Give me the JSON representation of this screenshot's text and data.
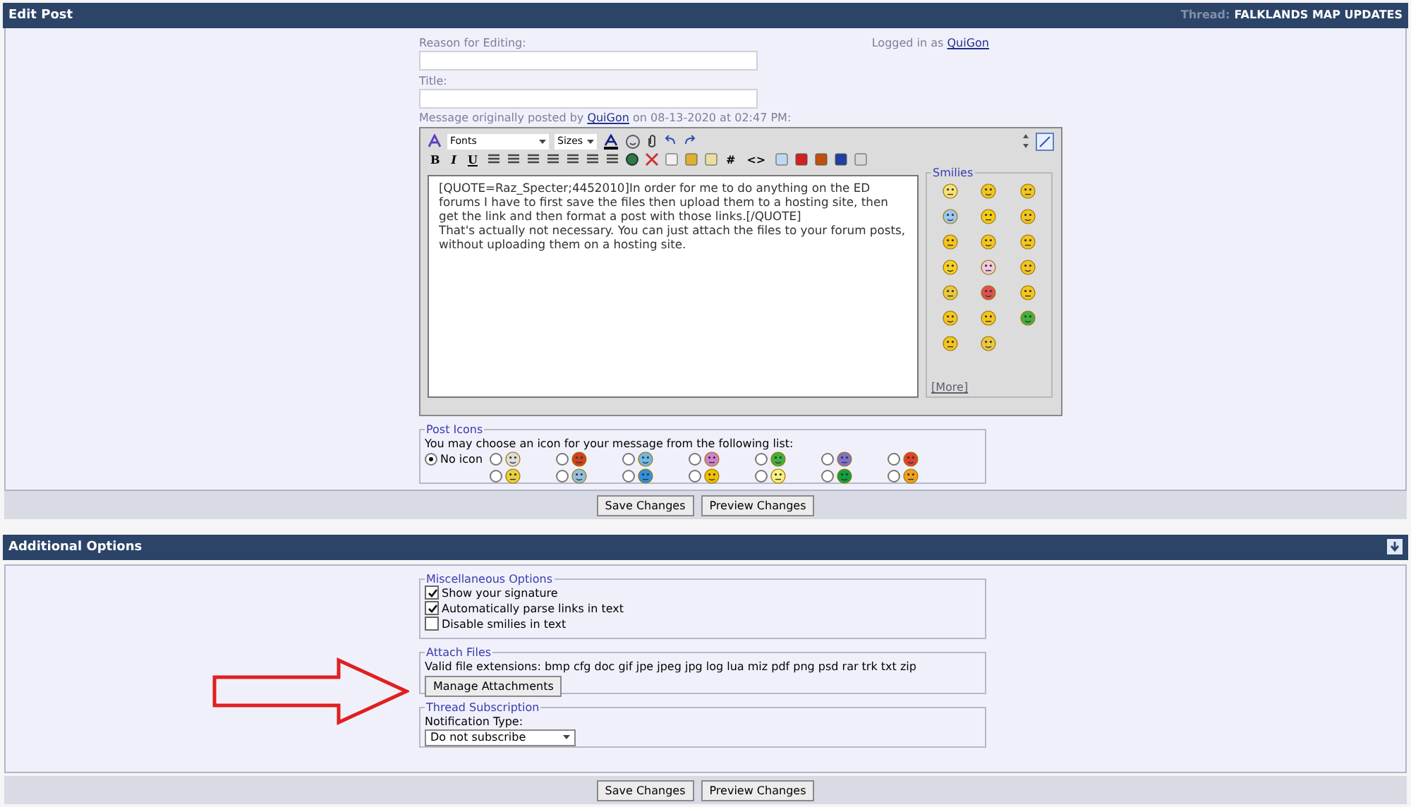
{
  "edit_post": {
    "title": "Edit Post",
    "thread_label": "Thread:",
    "thread_name": "FALKLANDS MAP UPDATES",
    "reason_label": "Reason for Editing:",
    "logged_in_text": "Logged in as",
    "logged_in_user": "QuiGon",
    "title_label": "Title:",
    "original_prefix": "Message originally posted by",
    "original_author": "QuiGon",
    "original_suffix": "on 08-13-2020 at 02:47 PM:",
    "editor": {
      "font_select": "Fonts",
      "size_select": "Sizes",
      "format_buttons": [
        "B",
        "I",
        "U"
      ],
      "hash_button": "#",
      "code_button": "<>",
      "message": "[QUOTE=Raz_Specter;4452010]In order for me to do anything on the ED forums I have to first save the files then upload them to a hosting site, then get the link and then format a post with those links.[/QUOTE]\nThat's actually not necessary. You can just attach the files to your forum posts, without uploading them on a hosting site.",
      "smilies_title": "Smilies",
      "more_link": "[More]"
    },
    "post_icons": {
      "title": "Post Icons",
      "instruction": "You may choose an icon for your message from the following list:",
      "options": [
        {
          "label": "No icon",
          "selected": true
        },
        {
          "selected": false
        },
        {
          "selected": false
        },
        {
          "selected": false
        },
        {
          "selected": false
        },
        {
          "selected": false
        },
        {
          "selected": false
        },
        {
          "selected": false
        },
        {
          "selected": false
        },
        {
          "selected": false
        },
        {
          "selected": false
        },
        {
          "selected": false
        },
        {
          "selected": false
        },
        {
          "selected": false
        },
        {
          "selected": false
        }
      ]
    },
    "buttons": [
      "Save Changes",
      "Preview Changes"
    ]
  },
  "additional_options": {
    "title": "Additional Options",
    "misc": {
      "title": "Miscellaneous Options",
      "options": [
        {
          "label": "Show your signature",
          "checked": true
        },
        {
          "label": "Automatically parse links in text",
          "checked": true
        },
        {
          "label": "Disable smilies in text",
          "checked": false
        }
      ]
    },
    "attach": {
      "title": "Attach Files",
      "extensions": "Valid file extensions: bmp cfg doc gif jpe jpeg jpg log lua miz pdf png psd rar trk txt zip",
      "button": "Manage Attachments"
    },
    "subscription": {
      "title": "Thread Subscription",
      "label": "Notification Type:",
      "value": "Do not subscribe"
    },
    "buttons": [
      "Save Changes",
      "Preview Changes"
    ]
  }
}
